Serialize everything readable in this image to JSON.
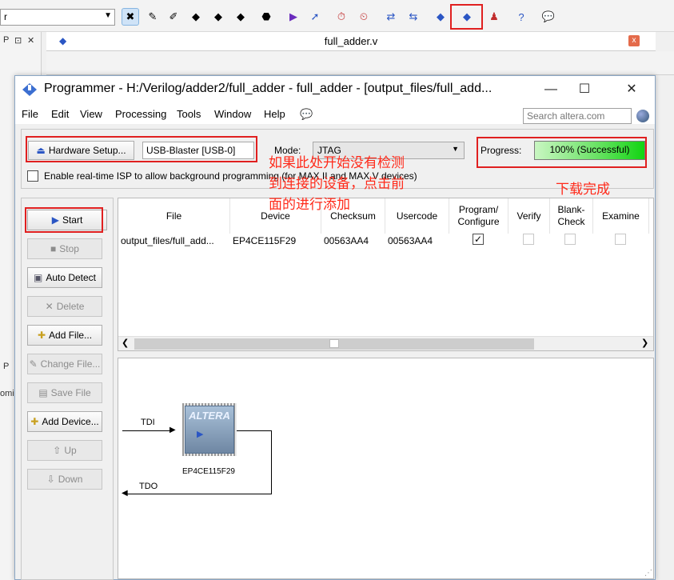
{
  "background_ide": {
    "combo_value": "r",
    "doc_title": "full_adder.v",
    "left_labels": [
      "P",
      "P",
      "omiz"
    ],
    "tab_close": "x"
  },
  "window": {
    "title": "Programmer - H:/Verilog/adder2/full_adder - full_adder - [output_files/full_add...",
    "minimize": "—",
    "maximize": "☐",
    "close": "✕"
  },
  "menu": [
    "File",
    "Edit",
    "View",
    "Processing",
    "Tools",
    "Window",
    "Help"
  ],
  "search": {
    "placeholder": "Search altera.com"
  },
  "hardware": {
    "setup_button": "Hardware Setup...",
    "device": "USB-Blaster [USB-0]",
    "mode_label": "Mode:",
    "mode_value": "JTAG",
    "progress_label": "Progress:",
    "progress_text": "100% (Successful)",
    "progress_value": 100,
    "isp_label": "Enable real-time ISP to allow background programming (for MAX II and MAX V devices)",
    "isp_checked": false
  },
  "buttons": {
    "start": "Start",
    "stop": "Stop",
    "auto_detect": "Auto Detect",
    "delete": "Delete",
    "add_file": "Add File...",
    "change_file": "Change File...",
    "save_file": "Save File",
    "add_device": "Add Device...",
    "up": "Up",
    "down": "Down"
  },
  "table": {
    "columns": [
      "File",
      "Device",
      "Checksum",
      "Usercode",
      "Program/\nConfigure",
      "Verify",
      "Blank-\nCheck",
      "Examine"
    ],
    "rows": [
      {
        "file": "output_files/full_add...",
        "device": "EP4CE115F29",
        "checksum": "00563AA4",
        "usercode": "00563AA4",
        "program": true,
        "verify": false,
        "blank": false,
        "examine": false
      }
    ]
  },
  "chain": {
    "tdi": "TDI",
    "tdo": "TDO",
    "chip_logo": "ALTERA",
    "chip_label": "EP4CE115F29"
  },
  "annotations": {
    "hint_line1": "如果此处开始没有检测",
    "hint_line2": "到连接的设备，点击前",
    "hint_line3": "面的进行添加",
    "done": "下载完成"
  },
  "colors": {
    "accent_red": "#e02020",
    "progress_green": "#12d412",
    "annot_red": "#ff2a1a"
  }
}
